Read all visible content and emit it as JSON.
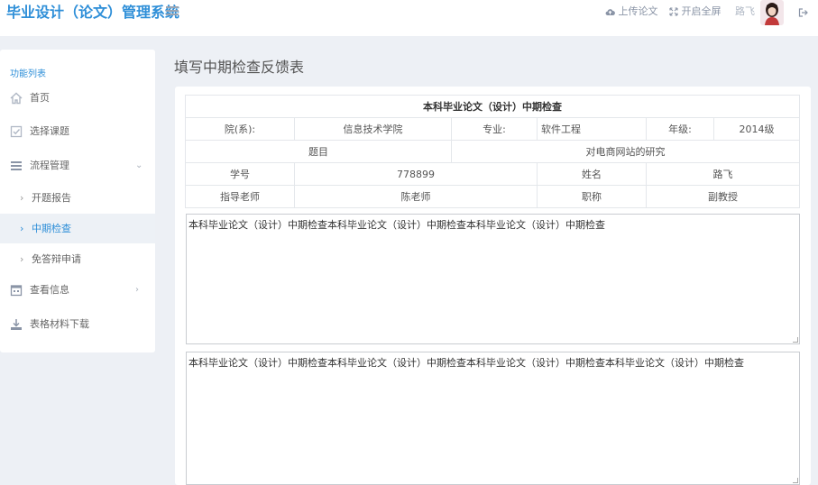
{
  "header": {
    "app_title": "毕业设计（论文）管理系统",
    "upload_label": "上传论文",
    "fullscreen_label": "开启全屏",
    "user_name": "路飞"
  },
  "sidebar": {
    "header": "功能列表",
    "items": [
      {
        "label": "首页",
        "icon": "home-icon"
      },
      {
        "label": "选择课题",
        "icon": "checkbox-icon"
      },
      {
        "label": "流程管理",
        "icon": "list-icon"
      },
      {
        "label": "开题报告"
      },
      {
        "label": "中期检查"
      },
      {
        "label": "免答辩申请"
      },
      {
        "label": "查看信息",
        "icon": "calendar-icon"
      },
      {
        "label": "表格材料下载",
        "icon": "download-icon"
      }
    ],
    "active": "中期检查"
  },
  "main": {
    "page_title": "填写中期检查反馈表",
    "form": {
      "caption": "本科毕业论文（设计）中期检查",
      "dept_label": "院(系):",
      "dept_value": "信息技术学院",
      "major_label": "专业:",
      "major_value": "软件工程",
      "grade_label": "年级:",
      "grade_value": "2014级",
      "topic_label": "题目",
      "topic_value": "对电商网站的研究",
      "student_id_label": "学号",
      "student_id_value": "778899",
      "name_label": "姓名",
      "name_value": "路飞",
      "advisor_label": "指导老师",
      "advisor_value": "陈老师",
      "title_label": "职称",
      "title_value": "副教授"
    },
    "textarea1": "本科毕业论文（设计）中期检查本科毕业论文（设计）中期检查本科毕业论文（设计）中期检查",
    "textarea2": "本科毕业论文（设计）中期检查本科毕业论文（设计）中期检查本科毕业论文（设计）中期检查本科毕业论文（设计）中期检查"
  },
  "colors": {
    "accent": "#2f8fd8",
    "background": "#edf0f5"
  }
}
